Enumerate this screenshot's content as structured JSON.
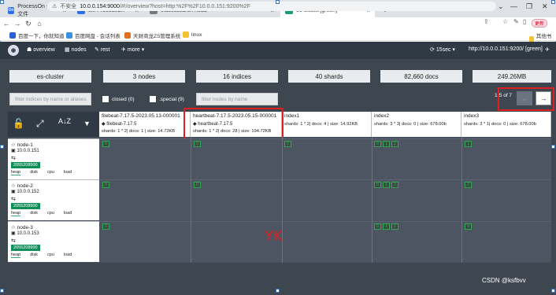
{
  "browser": {
    "tabs": [
      {
        "label": "ProcessOn - 我的文件",
        "fav": "On",
        "favcolor": "#2d6ef0"
      },
      {
        "label": "elk-ProcessOn",
        "fav": "On",
        "favcolor": "#2d6ef0"
      },
      {
        "label": "elasticsearch-head",
        "fav": "",
        "favcolor": "#777"
      },
      {
        "label": "es-cluster[green]",
        "fav": "",
        "favcolor": "#1a9a7a"
      }
    ],
    "new_tab": "+",
    "insecure_label": "不安全",
    "url_host": "10.0.0.154:9000",
    "url_rest": "/#!/overview?host=http:%2F%2F10.0.0.151:9200%2F",
    "update_label": "更新",
    "bookmarks": [
      "百度一下，你就知道",
      "百度网盘 - 会话列表",
      "天财商龙ZS管理系统",
      "linux"
    ],
    "bookmarks_other": "其他书签"
  },
  "eshead": {
    "nav": [
      "overview",
      "nodes",
      "rest",
      "more ▾"
    ],
    "refresh": "15sec ▾",
    "cluster_url": "http://10.0.0.151:9200/ [green]"
  },
  "stats": [
    "es-cluster",
    "3 nodes",
    "16 indices",
    "40 shards",
    "82,660 docs",
    "249.26MB"
  ],
  "filters": {
    "index_placeholder": "filter indices by name or aliases",
    "closed_label": "closed (0)",
    "special_label": ".special (9)",
    "node_placeholder": "filter nodes by name",
    "pager": "1-5 of 7",
    "prev": "←",
    "next": "→"
  },
  "indices": [
    {
      "name": "filebeat-7.17.5-2023.05.13-000001",
      "alias": "filebeat-7.17.5",
      "meta": "shards: 1 * 2| docs: 1 | size: 14.73KB"
    },
    {
      "name": "heartbeat-7.17.5-2023.05.15-000001",
      "alias": "heartbeat-7.17.5",
      "meta": "shards: 1 * 2| docs: 28 | size: 194.72KB"
    },
    {
      "name": "index1",
      "alias": "",
      "meta": "shards: 1 * 2| docs: 4 | size: 14.92KB"
    },
    {
      "name": "index2",
      "alias": "",
      "meta": "shards: 3 * 3| docs: 0 | size: 678.00b"
    },
    {
      "name": "index3",
      "alias": "",
      "meta": "shards: 3 * 1| docs: 0 | size: 678.00b"
    }
  ],
  "nodes": [
    {
      "name": "node-1",
      "ip": "10.0.0.151",
      "id": "2055208900",
      "metrics": [
        "heap",
        "disk",
        "cpu",
        "load"
      ]
    },
    {
      "name": "node-2",
      "ip": "10.0.0.152",
      "id": "2055208900",
      "metrics": [
        "heap",
        "disk",
        "cpu",
        "load"
      ]
    },
    {
      "name": "node-3",
      "ip": "10.0.0.153",
      "id": "2055208900",
      "metrics": [
        "heap",
        "disk",
        "cpu",
        "load"
      ]
    }
  ],
  "shards": {
    "node-1": [
      [
        "0"
      ],
      [
        "0"
      ],
      [
        "0"
      ],
      [
        "0",
        "1",
        "2"
      ],
      [
        "1"
      ]
    ],
    "node-2": [
      [
        "0"
      ],
      [
        "0"
      ],
      [],
      [
        "0",
        "1",
        "2"
      ],
      [
        "2"
      ]
    ],
    "node-3": [
      [
        "0"
      ],
      [],
      [],
      [
        "0",
        "1",
        "2"
      ],
      [
        "0"
      ]
    ]
  },
  "annotation": "YK",
  "watermark": "CSDN @ksfbvv"
}
